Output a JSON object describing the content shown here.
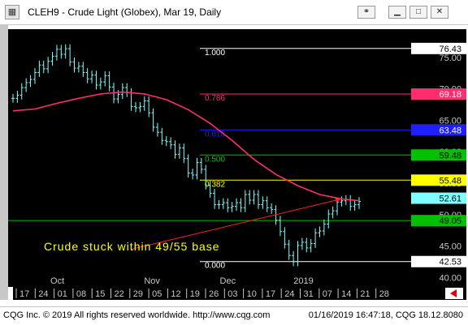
{
  "window": {
    "title": "CLEH9 - Crude Light (Globex), Mar 19, Daily",
    "buttons": [
      "link",
      "minimize",
      "maximize",
      "close"
    ]
  },
  "footer": {
    "left": "CQG Inc. © 2019 All rights reserved worldwide. http://www.cqg.com",
    "right": "01/16/2019 16:47:18, CQG 18.12.8080"
  },
  "colors": {
    "background": "#000000",
    "bars": "#7fffff",
    "ma_line": "#ff2d6e",
    "trend_arrow": "#ff2020",
    "support_line": "#00c000",
    "annotation": "#ffff00",
    "fib_1000": "#ffffff",
    "fib_786": "#ff2d6e",
    "fib_618": "#2020ff",
    "fib_500": "#00c000",
    "fib_382": "#ffff00",
    "fib_000": "#ffffff"
  },
  "chart_data": {
    "type": "line",
    "title": "CLEH9 - Crude Light (Globex), Mar 19, Daily",
    "y_axis": {
      "ylim": [
        38.5,
        79.5
      ],
      "ticks": [
        40.0,
        45.0,
        50.0,
        55.0,
        60.0,
        65.0,
        70.0,
        75.0
      ],
      "tick_labels": [
        "40.00",
        "45.00",
        "50.00",
        "55.00",
        "60.00",
        "65.00",
        "70.00",
        "75.00"
      ]
    },
    "x_axis": {
      "day_labels": [
        "17",
        "24",
        "01",
        "08",
        "15",
        "22",
        "29",
        "05",
        "12",
        "19",
        "26",
        "03",
        "10",
        "17",
        "24",
        "31",
        "07",
        "14",
        "21",
        "28"
      ],
      "month_labels": [
        {
          "label": "Oct",
          "at_index": 2
        },
        {
          "label": "Nov",
          "at_index": 7
        },
        {
          "label": "Dec",
          "at_index": 11
        },
        {
          "label": "2019",
          "at_index": 15
        }
      ]
    },
    "price_series": {
      "name": "",
      "close": [
        68.5,
        69.0,
        70.2,
        71.0,
        71.5,
        72.6,
        73.8,
        73.2,
        74.4,
        75.2,
        76.3,
        75.5,
        76.4,
        74.3,
        73.3,
        73.6,
        72.6,
        71.6,
        72.2,
        70.6,
        71.1,
        72.1,
        70.3,
        68.4,
        69.1,
        70.2,
        69.4,
        67.2,
        67.0,
        67.2,
        68.1,
        66.2,
        63.9,
        63.1,
        61.8,
        61.6,
        61.1,
        59.6,
        60.6,
        58.9,
        56.6,
        56.3,
        58.3,
        57.2,
        54.7,
        53.4,
        51.6,
        51.6,
        51.9,
        51.1,
        51.3,
        51.9,
        51.1,
        53.2,
        52.3,
        53.2,
        51.6,
        52.2,
        51.1,
        50.8,
        49.1,
        47.3,
        45.3,
        43.5,
        42.5,
        45.1,
        45.6,
        44.7,
        45.4,
        47.1,
        47.4,
        48.5,
        50.1,
        50.6,
        52.0,
        52.2,
        52.4,
        51.3,
        51.6,
        52.1
      ]
    },
    "moving_average": {
      "name": "",
      "values": [
        [
          0,
          66.5
        ],
        [
          5,
          66.8
        ],
        [
          10,
          67.7
        ],
        [
          15,
          68.5
        ],
        [
          20,
          69.2
        ],
        [
          25,
          69.5
        ],
        [
          30,
          69.2
        ],
        [
          35,
          68.3
        ],
        [
          40,
          66.7
        ],
        [
          45,
          64.5
        ],
        [
          50,
          61.8
        ],
        [
          55,
          58.8
        ],
        [
          60,
          56.4
        ],
        [
          65,
          54.6
        ],
        [
          70,
          53.2
        ],
        [
          75,
          52.5
        ],
        [
          79,
          52.2
        ]
      ]
    },
    "fibonacci_levels": [
      {
        "label": "1.000",
        "price": 76.43,
        "price_label": "76.43"
      },
      {
        "label": "0.786",
        "price": 69.18,
        "price_label": "69.18"
      },
      {
        "label": "0.618",
        "price": 63.48,
        "price_label": "63.48"
      },
      {
        "label": "0.500",
        "price": 59.48,
        "price_label": "59.48"
      },
      {
        "label": "0.382",
        "price": 55.48,
        "price_label": "55.48"
      },
      {
        "label": "0.000",
        "price": 42.53,
        "price_label": "42.53"
      }
    ],
    "last_price": {
      "price": 52.61,
      "label": "52.61"
    },
    "support_line": {
      "price": 49.05,
      "label": "49.05"
    },
    "trend_arrow": {
      "from": {
        "index": 40,
        "price": 46.3
      },
      "to": {
        "index": 75,
        "price": 52.5
      }
    },
    "annotation": "Crude stuck within 49/55 base",
    "grid": false
  }
}
